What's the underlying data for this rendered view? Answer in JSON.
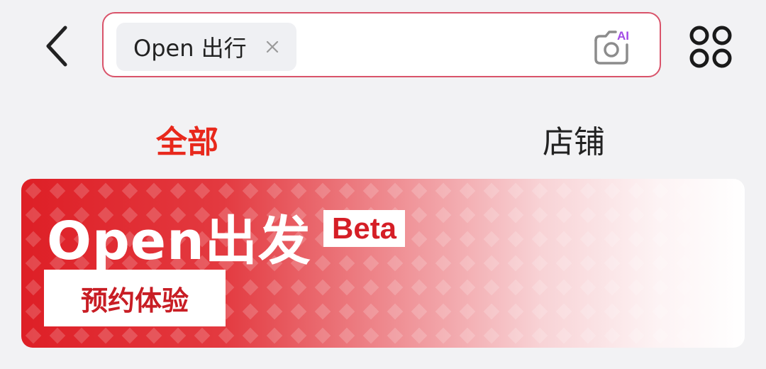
{
  "search": {
    "chip_text": "Open 出行",
    "camera_badge": "AI"
  },
  "tabs": [
    {
      "label": "全部",
      "active": true
    },
    {
      "label": "店铺",
      "active": false
    }
  ],
  "banner": {
    "title": "Open出发",
    "tag": "Beta",
    "button_label": "预约体验"
  },
  "icons": {
    "back": "chevron-left-icon",
    "chip_close": "close-icon",
    "camera": "camera-ai-icon",
    "menu": "grid-menu-icon"
  },
  "colors": {
    "accent": "#e8291c",
    "search_border": "#d9536a",
    "banner_red": "#de1f26",
    "ai_badge": "#a24be6"
  }
}
